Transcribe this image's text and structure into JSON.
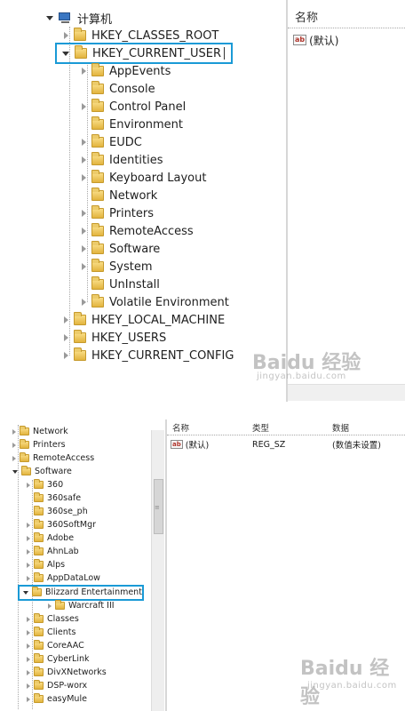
{
  "panel1": {
    "computer_label": "计算机",
    "header_name": "名称",
    "value_default": "(默认)",
    "value_icon_text": "ab",
    "hives": {
      "classes_root": "HKEY_CLASSES_ROOT",
      "current_user": "HKEY_CURRENT_USER",
      "local_machine": "HKEY_LOCAL_MACHINE",
      "users": "HKEY_USERS",
      "current_config": "HKEY_CURRENT_CONFIG"
    },
    "current_user_children": [
      "AppEvents",
      "Console",
      "Control Panel",
      "Environment",
      "EUDC",
      "Identities",
      "Keyboard Layout",
      "Network",
      "Printers",
      "RemoteAccess",
      "Software",
      "System",
      "UnInstall",
      "Volatile Environment"
    ]
  },
  "panel2": {
    "headers": {
      "name": "名称",
      "type": "类型",
      "data": "数据"
    },
    "value_row": {
      "name": "(默认)",
      "type": "REG_SZ",
      "data": "(数值未设置)",
      "icon_text": "ab"
    },
    "tree_top": [
      "Network",
      "Printers",
      "RemoteAccess",
      "Software"
    ],
    "software_children": [
      "360",
      "360safe",
      "360se_ph",
      "360SoftMgr",
      "Adobe",
      "AhnLab",
      "Alps",
      "AppDataLow",
      "Blizzard Entertainment"
    ],
    "blizzard_child": "Warcraft III",
    "software_children_after": [
      "Classes",
      "Clients",
      "CoreAAC",
      "CyberLink",
      "DivXNetworks",
      "DSP-worx",
      "easyMule"
    ]
  },
  "watermark": {
    "brand": "Baidu",
    "cn": "经验",
    "url": "jingyan.baidu.com"
  },
  "colors": {
    "highlight_border": "#1a9ad6",
    "folder": "#e8c25a"
  }
}
